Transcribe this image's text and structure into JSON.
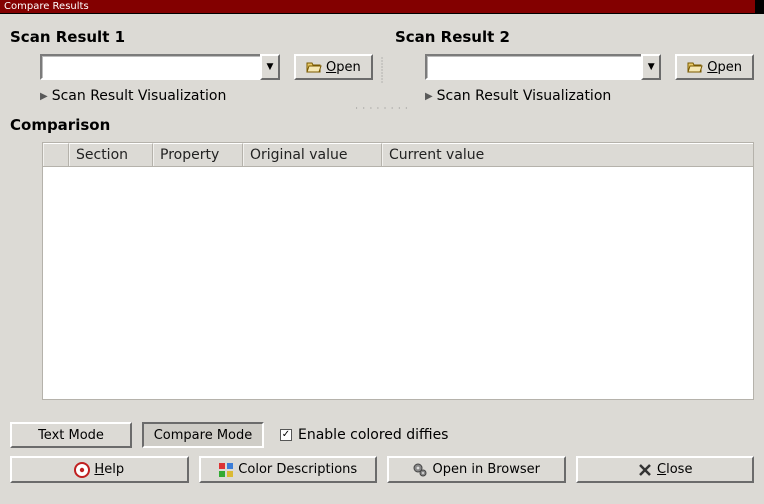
{
  "window": {
    "title": "Compare Results"
  },
  "scan1": {
    "heading": "Scan Result 1",
    "value": "",
    "open_label": "Open",
    "open_mnemonic": "O",
    "visualization_label": "Scan Result Visualization"
  },
  "scan2": {
    "heading": "Scan Result 2",
    "value": "",
    "open_label": "Open",
    "open_mnemonic": "O",
    "visualization_label": "Scan Result Visualization"
  },
  "comparison": {
    "heading": "Comparison",
    "columns": {
      "c0": "",
      "c1": "Section",
      "c2": "Property",
      "c3": "Original value",
      "c4": "Current value"
    },
    "rows": []
  },
  "toggles": {
    "text_mode": "Text Mode",
    "compare_mode": "Compare Mode",
    "enable_diffies": "Enable colored diffies",
    "enable_diffies_checked": true
  },
  "footer": {
    "help": {
      "label": "Help",
      "mnemonic": "H"
    },
    "color_desc": {
      "label": "Color Descriptions"
    },
    "open_browser": {
      "label": "Open in Browser"
    },
    "close": {
      "label": "Close",
      "mnemonic": "C"
    }
  },
  "icons": {
    "folder_open": "folder-open-icon",
    "help": "help-icon",
    "palette": "palette-icon",
    "gears": "gears-icon",
    "close_x": "close-x-icon"
  }
}
